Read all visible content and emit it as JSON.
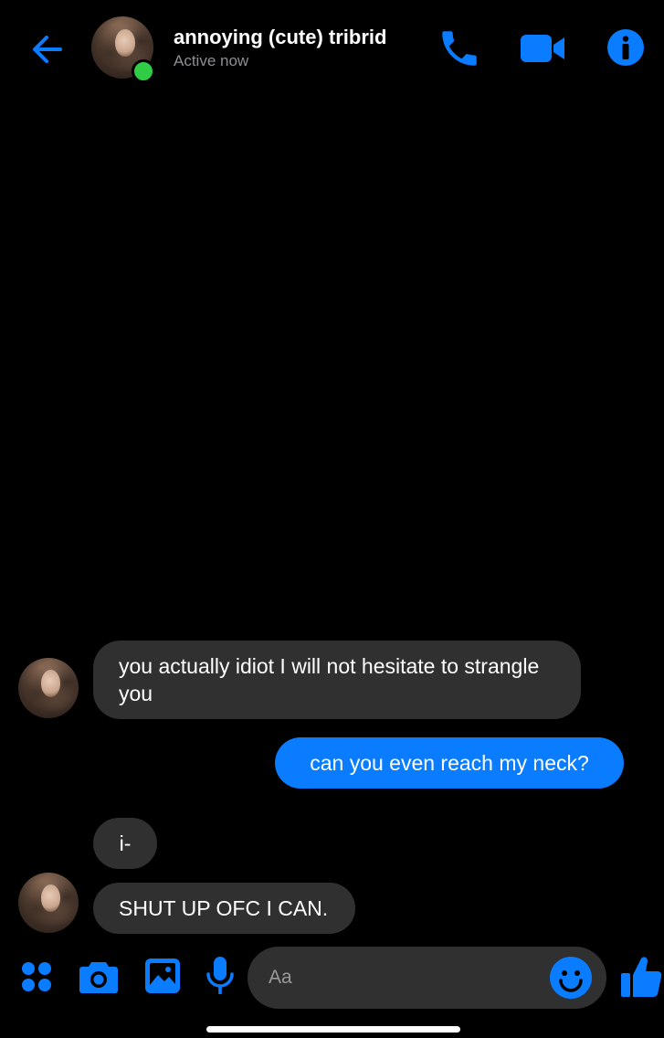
{
  "theme": {
    "background": "#000000",
    "accent": "#0a7cff",
    "incoming_bubble": "#303030",
    "online": "#31cc46"
  },
  "header": {
    "back_icon": "arrow-left-icon",
    "contact_name": "annoying (cute) tribrid",
    "status": "Active now",
    "actions": [
      "phone-icon",
      "video-camera-icon",
      "info-icon"
    ]
  },
  "messages": [
    {
      "direction": "incoming",
      "text": "you actually idiot I will not hesitate to strangle you"
    },
    {
      "direction": "outgoing",
      "text": "can you even reach my neck?"
    },
    {
      "direction": "incoming",
      "text": "i-"
    },
    {
      "direction": "incoming",
      "text": "SHUT UP OFC I CAN."
    }
  ],
  "composer": {
    "placeholder": "Aa",
    "icons": [
      "apps-grid-icon",
      "camera-icon",
      "gallery-icon",
      "microphone-icon",
      "emoji-icon",
      "thumbs-up-icon"
    ]
  }
}
